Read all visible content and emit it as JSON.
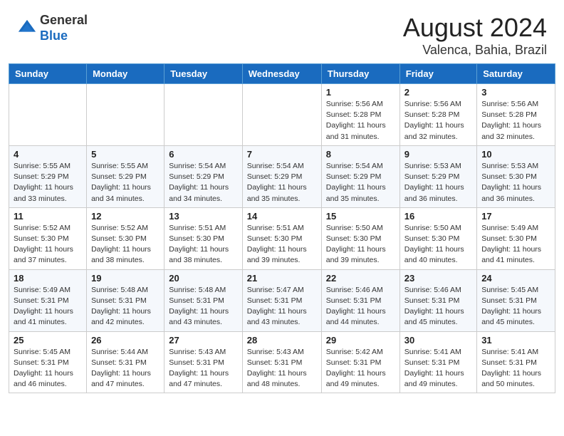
{
  "header": {
    "logo_general": "General",
    "logo_blue": "Blue",
    "main_title": "August 2024",
    "sub_title": "Valenca, Bahia, Brazil"
  },
  "days_of_week": [
    "Sunday",
    "Monday",
    "Tuesday",
    "Wednesday",
    "Thursday",
    "Friday",
    "Saturday"
  ],
  "weeks": [
    {
      "days": [
        {
          "num": "",
          "info": ""
        },
        {
          "num": "",
          "info": ""
        },
        {
          "num": "",
          "info": ""
        },
        {
          "num": "",
          "info": ""
        },
        {
          "num": "1",
          "info": "Sunrise: 5:56 AM\nSunset: 5:28 PM\nDaylight: 11 hours\nand 31 minutes."
        },
        {
          "num": "2",
          "info": "Sunrise: 5:56 AM\nSunset: 5:28 PM\nDaylight: 11 hours\nand 32 minutes."
        },
        {
          "num": "3",
          "info": "Sunrise: 5:56 AM\nSunset: 5:28 PM\nDaylight: 11 hours\nand 32 minutes."
        }
      ]
    },
    {
      "days": [
        {
          "num": "4",
          "info": "Sunrise: 5:55 AM\nSunset: 5:29 PM\nDaylight: 11 hours\nand 33 minutes."
        },
        {
          "num": "5",
          "info": "Sunrise: 5:55 AM\nSunset: 5:29 PM\nDaylight: 11 hours\nand 34 minutes."
        },
        {
          "num": "6",
          "info": "Sunrise: 5:54 AM\nSunset: 5:29 PM\nDaylight: 11 hours\nand 34 minutes."
        },
        {
          "num": "7",
          "info": "Sunrise: 5:54 AM\nSunset: 5:29 PM\nDaylight: 11 hours\nand 35 minutes."
        },
        {
          "num": "8",
          "info": "Sunrise: 5:54 AM\nSunset: 5:29 PM\nDaylight: 11 hours\nand 35 minutes."
        },
        {
          "num": "9",
          "info": "Sunrise: 5:53 AM\nSunset: 5:29 PM\nDaylight: 11 hours\nand 36 minutes."
        },
        {
          "num": "10",
          "info": "Sunrise: 5:53 AM\nSunset: 5:30 PM\nDaylight: 11 hours\nand 36 minutes."
        }
      ]
    },
    {
      "days": [
        {
          "num": "11",
          "info": "Sunrise: 5:52 AM\nSunset: 5:30 PM\nDaylight: 11 hours\nand 37 minutes."
        },
        {
          "num": "12",
          "info": "Sunrise: 5:52 AM\nSunset: 5:30 PM\nDaylight: 11 hours\nand 38 minutes."
        },
        {
          "num": "13",
          "info": "Sunrise: 5:51 AM\nSunset: 5:30 PM\nDaylight: 11 hours\nand 38 minutes."
        },
        {
          "num": "14",
          "info": "Sunrise: 5:51 AM\nSunset: 5:30 PM\nDaylight: 11 hours\nand 39 minutes."
        },
        {
          "num": "15",
          "info": "Sunrise: 5:50 AM\nSunset: 5:30 PM\nDaylight: 11 hours\nand 39 minutes."
        },
        {
          "num": "16",
          "info": "Sunrise: 5:50 AM\nSunset: 5:30 PM\nDaylight: 11 hours\nand 40 minutes."
        },
        {
          "num": "17",
          "info": "Sunrise: 5:49 AM\nSunset: 5:30 PM\nDaylight: 11 hours\nand 41 minutes."
        }
      ]
    },
    {
      "days": [
        {
          "num": "18",
          "info": "Sunrise: 5:49 AM\nSunset: 5:31 PM\nDaylight: 11 hours\nand 41 minutes."
        },
        {
          "num": "19",
          "info": "Sunrise: 5:48 AM\nSunset: 5:31 PM\nDaylight: 11 hours\nand 42 minutes."
        },
        {
          "num": "20",
          "info": "Sunrise: 5:48 AM\nSunset: 5:31 PM\nDaylight: 11 hours\nand 43 minutes."
        },
        {
          "num": "21",
          "info": "Sunrise: 5:47 AM\nSunset: 5:31 PM\nDaylight: 11 hours\nand 43 minutes."
        },
        {
          "num": "22",
          "info": "Sunrise: 5:46 AM\nSunset: 5:31 PM\nDaylight: 11 hours\nand 44 minutes."
        },
        {
          "num": "23",
          "info": "Sunrise: 5:46 AM\nSunset: 5:31 PM\nDaylight: 11 hours\nand 45 minutes."
        },
        {
          "num": "24",
          "info": "Sunrise: 5:45 AM\nSunset: 5:31 PM\nDaylight: 11 hours\nand 45 minutes."
        }
      ]
    },
    {
      "days": [
        {
          "num": "25",
          "info": "Sunrise: 5:45 AM\nSunset: 5:31 PM\nDaylight: 11 hours\nand 46 minutes."
        },
        {
          "num": "26",
          "info": "Sunrise: 5:44 AM\nSunset: 5:31 PM\nDaylight: 11 hours\nand 47 minutes."
        },
        {
          "num": "27",
          "info": "Sunrise: 5:43 AM\nSunset: 5:31 PM\nDaylight: 11 hours\nand 47 minutes."
        },
        {
          "num": "28",
          "info": "Sunrise: 5:43 AM\nSunset: 5:31 PM\nDaylight: 11 hours\nand 48 minutes."
        },
        {
          "num": "29",
          "info": "Sunrise: 5:42 AM\nSunset: 5:31 PM\nDaylight: 11 hours\nand 49 minutes."
        },
        {
          "num": "30",
          "info": "Sunrise: 5:41 AM\nSunset: 5:31 PM\nDaylight: 11 hours\nand 49 minutes."
        },
        {
          "num": "31",
          "info": "Sunrise: 5:41 AM\nSunset: 5:31 PM\nDaylight: 11 hours\nand 50 minutes."
        }
      ]
    }
  ]
}
